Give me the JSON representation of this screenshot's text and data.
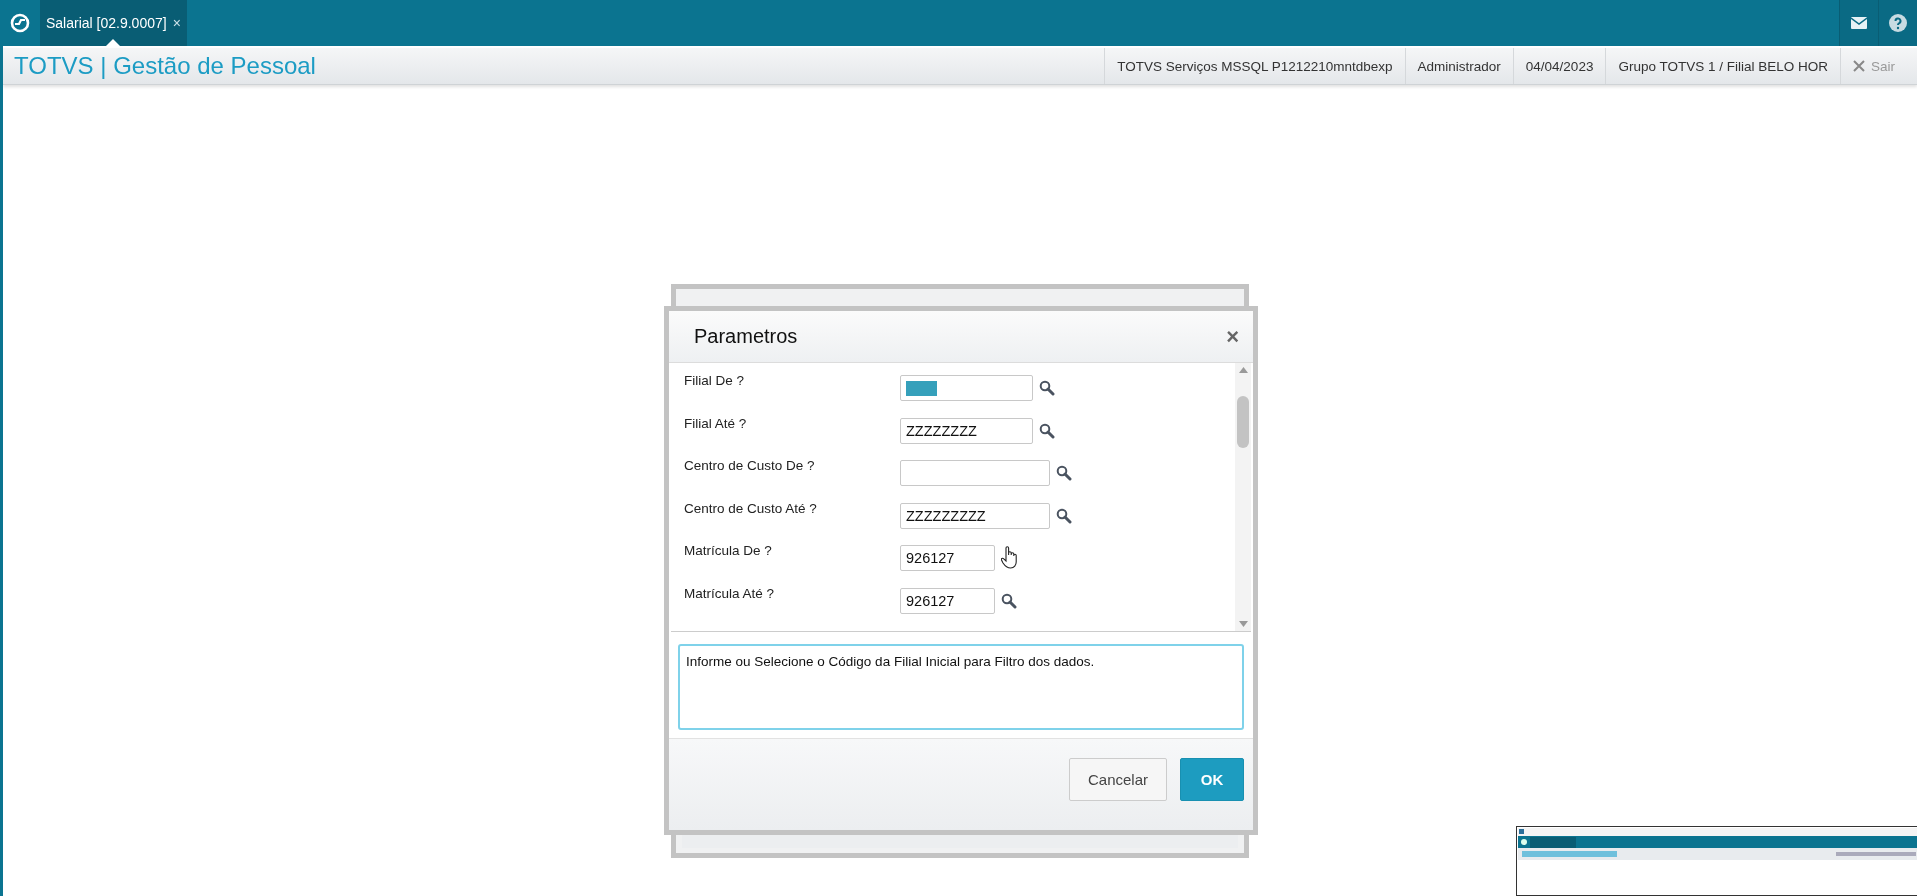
{
  "top_bar": {
    "tabs": [
      {
        "label": "Salarial [02.9.0007]",
        "close": "×",
        "selected": true
      }
    ]
  },
  "header": {
    "title": "TOTVS | Gestão de Pessoal",
    "info": [
      "TOTVS Serviços MSSQL P1212210mntdbexp",
      "Administrador",
      "04/04/2023",
      "Grupo TOTVS 1 / Filial BELO HOR"
    ],
    "exit": "Sair"
  },
  "dialog": {
    "title": "Parametros",
    "close": "×",
    "fields": [
      {
        "label": "Filial De ?",
        "highlighted": true,
        "hovered": false
      },
      {
        "label": "Filial Até ?",
        "value": "ZZZZZZZZ",
        "highlighted": false,
        "hovered": false
      },
      {
        "label": "Centro de Custo De ?",
        "highlighted": false,
        "hovered": false
      },
      {
        "label": "Centro de Custo Até ?",
        "value": "ZZZZZZZZZ",
        "highlighted": false,
        "hovered": false
      },
      {
        "label": "Matrícula De ?",
        "value": "926127",
        "highlighted": false,
        "hovered": true
      },
      {
        "label": "Matrícula Até ?",
        "value": "926127",
        "highlighted": false,
        "hovered": false
      }
    ],
    "help": "Informe ou Selecione o Código da Filial Inicial para Filtro dos dados.",
    "buttons": [
      {
        "label": "Cancelar",
        "kind": "secondary"
      },
      {
        "label": "OK",
        "kind": "primary"
      }
    ]
  }
}
